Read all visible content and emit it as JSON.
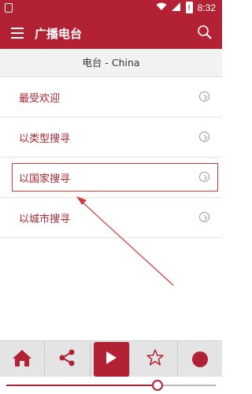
{
  "status_bar": {
    "time": "8:32",
    "battery_label": "!"
  },
  "app_bar": {
    "title": "广播电台",
    "menu_icon": "hamburger-menu-icon",
    "search_icon": "search-icon"
  },
  "sub_header": {
    "title": "电台 - China"
  },
  "list": {
    "items": [
      {
        "label": "最受欢迎"
      },
      {
        "label": "以类型搜寻"
      },
      {
        "label": "以国家搜寻",
        "highlighted": true
      },
      {
        "label": "以城市搜寻"
      }
    ]
  },
  "bottom_bar": {
    "buttons": [
      "home-icon",
      "share-icon",
      "play-icon",
      "star-icon",
      "record-icon"
    ]
  },
  "progress": {
    "value_fraction": 0.72
  },
  "colors": {
    "brand": "#b22234",
    "highlight": "#d23a3a"
  }
}
